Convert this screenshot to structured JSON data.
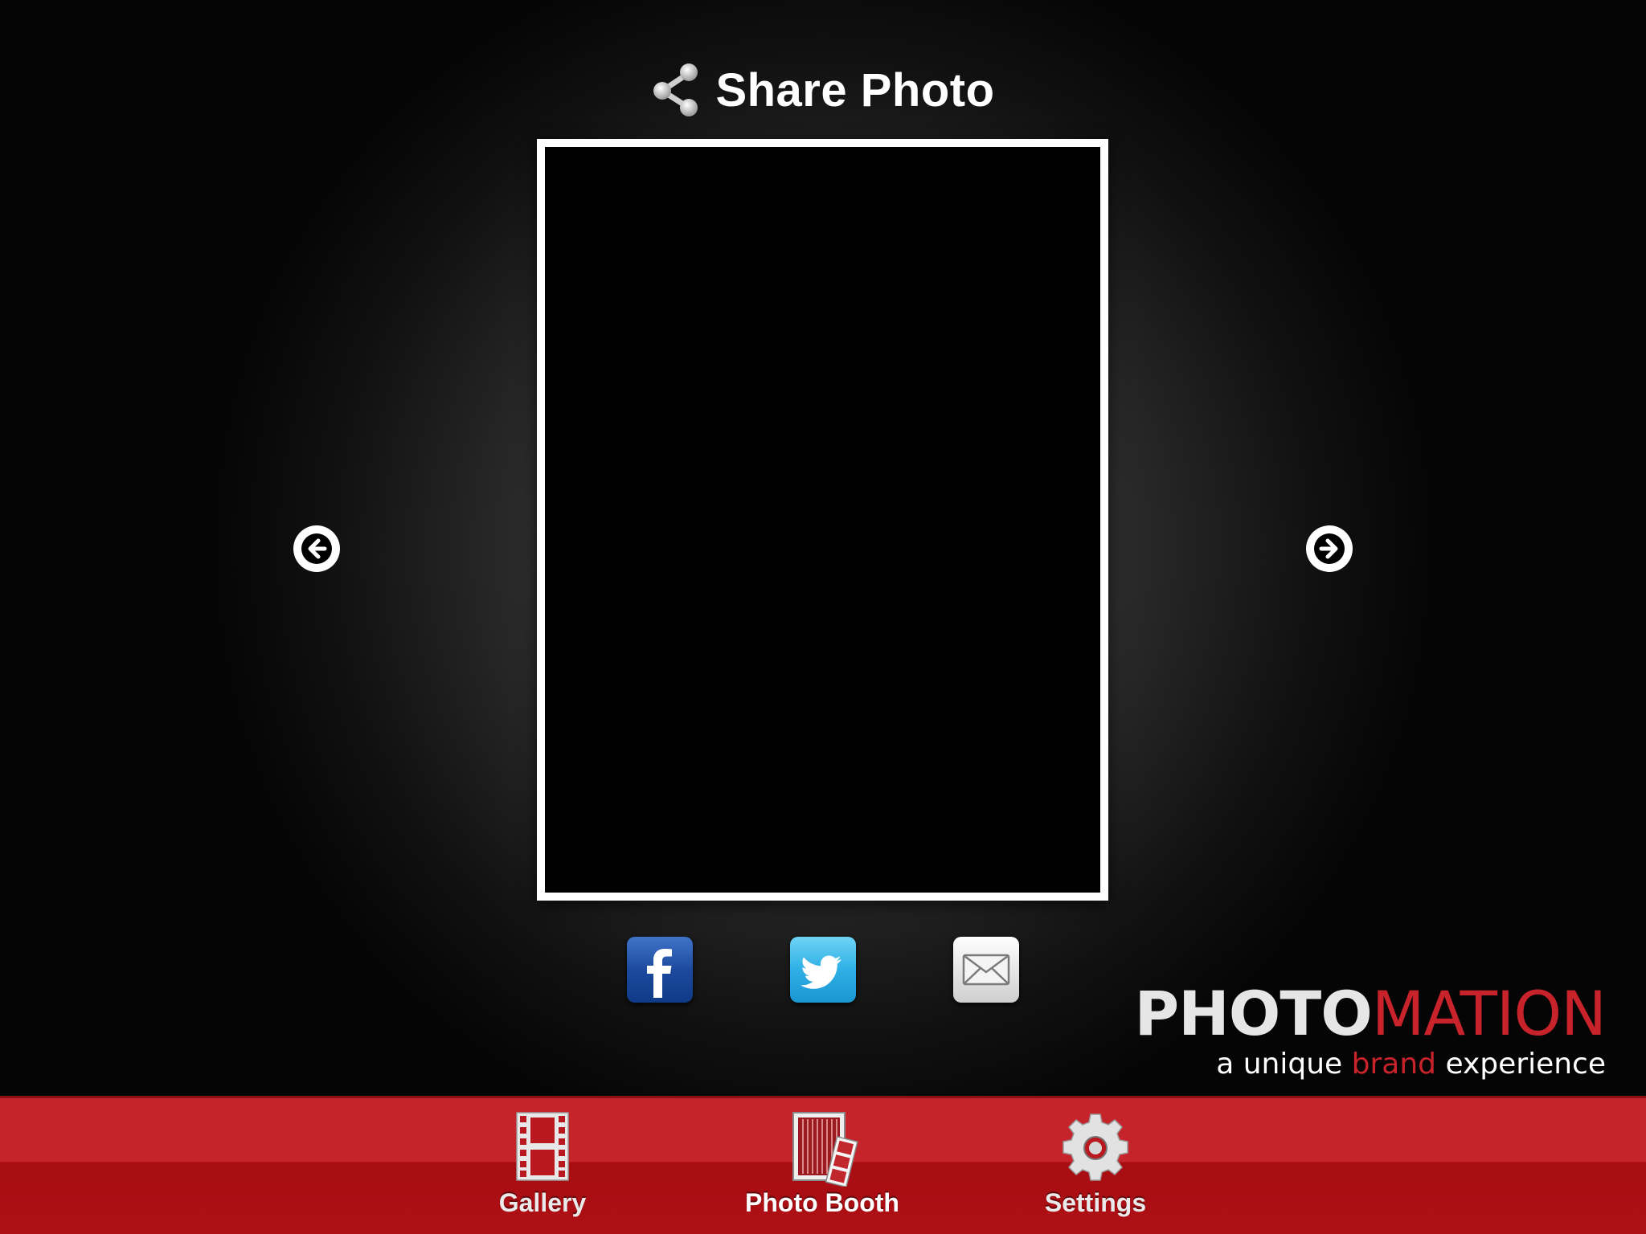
{
  "header": {
    "title": "Share Photo",
    "icon": "share-icon"
  },
  "photo": {
    "content": ""
  },
  "navigation": {
    "previous_icon": "arrow-left-icon",
    "next_icon": "arrow-right-icon"
  },
  "share_buttons": [
    {
      "name": "facebook",
      "icon": "facebook-icon"
    },
    {
      "name": "twitter",
      "icon": "twitter-icon"
    },
    {
      "name": "email",
      "icon": "mail-icon"
    }
  ],
  "brand": {
    "logo_part1": "PHOTO",
    "logo_part2": "MATION",
    "tagline_prefix": "a unique ",
    "tagline_accent": "brand",
    "tagline_suffix": " experience",
    "accent_color": "#c8232b"
  },
  "tabbar": {
    "tabs": [
      {
        "label": "Gallery",
        "icon": "film-strip-icon",
        "active": false
      },
      {
        "label": "Photo Booth",
        "icon": "photo-booth-icon",
        "active": true
      },
      {
        "label": "Settings",
        "icon": "gear-icon",
        "active": false
      }
    ],
    "color": "#c4242a"
  }
}
